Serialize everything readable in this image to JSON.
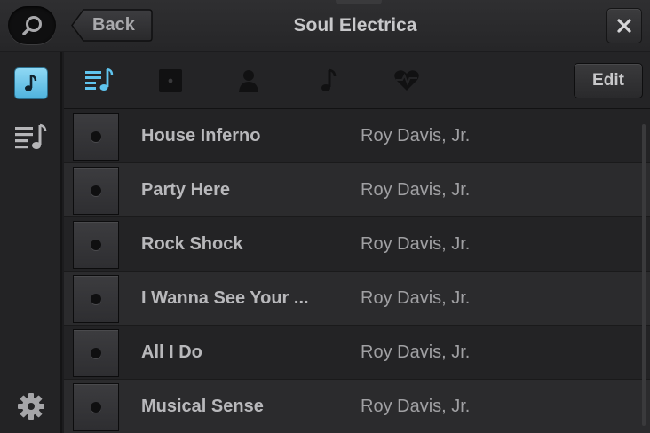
{
  "header": {
    "title": "Soul Electrica",
    "back_label": "Back",
    "icons": {
      "search": "search-icon",
      "close": "close-icon"
    }
  },
  "sidebar": {
    "items": [
      {
        "icon": "music-note-icon",
        "active": true
      },
      {
        "icon": "playlist-icon",
        "active": false
      },
      {
        "icon": "gear-icon",
        "active": false
      }
    ]
  },
  "toolbar": {
    "tabs": [
      {
        "icon": "playlist-icon",
        "active": true
      },
      {
        "icon": "album-icon",
        "active": false
      },
      {
        "icon": "artist-icon",
        "active": false
      },
      {
        "icon": "song-icon",
        "active": false
      },
      {
        "icon": "heart-rate-icon",
        "active": false
      }
    ],
    "edit_label": "Edit"
  },
  "tracks": [
    {
      "name": "House Inferno",
      "artist": "Roy Davis, Jr."
    },
    {
      "name": "Party Here",
      "artist": "Roy Davis, Jr."
    },
    {
      "name": "Rock Shock",
      "artist": "Roy Davis, Jr."
    },
    {
      "name": "I Wanna See Your ...",
      "artist": "Roy Davis, Jr."
    },
    {
      "name": "All I Do",
      "artist": "Roy Davis, Jr."
    },
    {
      "name": "Musical Sense",
      "artist": "Roy Davis, Jr."
    }
  ],
  "colors": {
    "accent": "#5fc4ee",
    "background": "#1c1c1e",
    "row_odd": "#232325",
    "row_even": "#2b2b2d"
  }
}
